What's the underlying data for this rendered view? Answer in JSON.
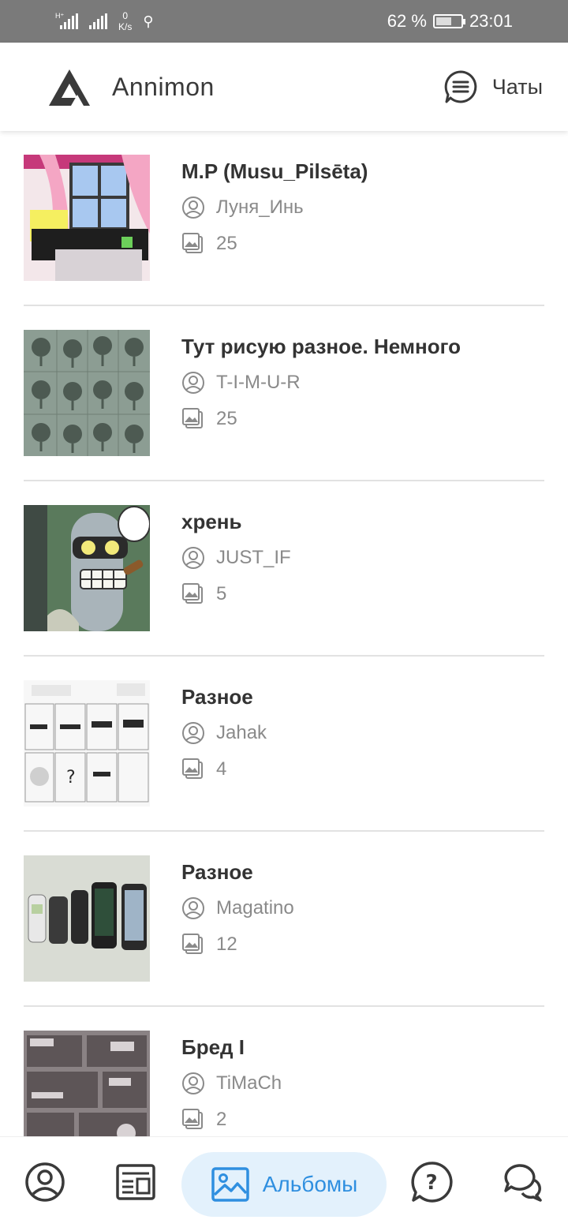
{
  "status_bar": {
    "network_label": "H⁺",
    "speed_value": "0",
    "speed_unit": "K/s",
    "battery_percent": "62 %",
    "battery_level": 0.62,
    "time": "23:01"
  },
  "header": {
    "app_name": "Annimon",
    "chats_label": "Чаты"
  },
  "albums": [
    {
      "title": "M.P (Musu_Pilsēta)",
      "author": "Луня_Инь",
      "count": "25",
      "thumb": "window-drawing"
    },
    {
      "title": "Тут рисую разное. Немного",
      "author": "T-I-M-U-R",
      "count": "25",
      "thumb": "trees-sketch"
    },
    {
      "title": "хрень",
      "author": "JUST_IF",
      "count": "5",
      "thumb": "robot-cartoon"
    },
    {
      "title": "Разное",
      "author": "Jahak",
      "count": "4",
      "thumb": "comic-strip"
    },
    {
      "title": "Разное",
      "author": "Magatino",
      "count": "12",
      "thumb": "phones-photo"
    },
    {
      "title": "Бред I",
      "author": "TiMaCh",
      "count": "2",
      "thumb": "manga-page"
    }
  ],
  "bottom_nav": {
    "active_label": "Альбомы",
    "items": [
      "profile-icon",
      "news-icon",
      "albums-icon",
      "help-icon",
      "forum-icon"
    ]
  },
  "colors": {
    "status_bar": "#7a7a7a",
    "accent": "#2f8fe0",
    "active_pill": "#e3f1fc",
    "title_text": "#333333",
    "meta_text": "#8a8a8a"
  }
}
